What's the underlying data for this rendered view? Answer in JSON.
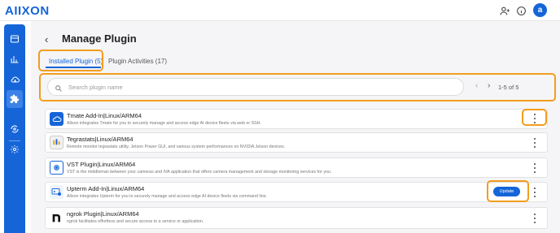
{
  "app": {
    "logo_text": "AIIXON",
    "avatar_letter": "a"
  },
  "header_icons": [
    "person-add-icon",
    "info-icon"
  ],
  "sidebar": {
    "items": [
      {
        "icon": "dashboard-icon",
        "active": false
      },
      {
        "icon": "bar-chart-icon",
        "active": false
      },
      {
        "icon": "cloud-icon",
        "active": false
      },
      {
        "icon": "puzzle-icon",
        "active": true
      },
      {
        "icon": "sync-settings-icon",
        "active": false
      },
      {
        "icon": "gear-icon",
        "active": false
      }
    ]
  },
  "page": {
    "back_glyph": "‹",
    "title": "Manage Plugin"
  },
  "tabs": [
    {
      "label": "Installed Plugin (5)",
      "active": true
    },
    {
      "label": "Plugin Activities (17)",
      "active": false
    }
  ],
  "search": {
    "placeholder": "Search plugin name"
  },
  "pagination": {
    "range": "1-5 of 5"
  },
  "plugins": [
    {
      "name": "Tmate Add-In|Linux/ARM64",
      "description": "Allxon integrates Tmate for you to securely manage and access edge AI device fleets via web or SSH.",
      "logo": "tmate-logo"
    },
    {
      "name": "Tegrastats|Linux/ARM64",
      "description": "Remote monitor tegrastats utility, Jetson Power GUI, and various system performances on NVIDIA Jetson devices.",
      "logo": "tegrastats-logo"
    },
    {
      "name": "VST Plugin|Linux/ARM64",
      "description": "VST is the middleman between your cameras and IVA application that offers camera management and storage monitoring services for you.",
      "logo": "vst-logo"
    },
    {
      "name": "Upterm Add-In|Linux/ARM64",
      "description": "Allxon integrates Upterm for you to securely manage and access edge AI device fleets via command line.",
      "logo": "upterm-logo",
      "action_label": "Update"
    },
    {
      "name": "ngrok Plugin|Linux/ARM64",
      "description": "ngrok facilitates effortless and secure access to a service or application.",
      "logo": "ngrok-logo"
    }
  ],
  "colors": {
    "accent": "#1565d8",
    "highlight": "#f29d1e"
  }
}
